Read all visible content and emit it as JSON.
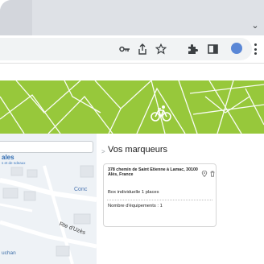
{
  "browser": {
    "icons": [
      {
        "name": "key-icon",
        "glyph": "⊶"
      },
      {
        "name": "share-icon",
        "glyph": ""
      },
      {
        "name": "star-icon",
        "glyph": "☆"
      },
      {
        "name": "extensions-icon",
        "glyph": ""
      },
      {
        "name": "side-panel-icon",
        "glyph": ""
      }
    ],
    "tab_dropdown_glyph": "⌄",
    "profile_color": "#5a87d6"
  },
  "banner": {
    "color": "#97c83b",
    "line_color": "#ffffff",
    "icon": "bicycle-icon"
  },
  "map": {
    "label_main": "ales",
    "label_sub": "s et de ndeaux",
    "label_conc": "Conc",
    "label_road": "Rte d'Uzès",
    "label_bottom": "uchan"
  },
  "panel": {
    "caret": ">",
    "title": "Vos marqueurs",
    "card": {
      "address": "378 chemin de Saint Etienne à Lamac, 30100 Alès, France",
      "type": "Box individuelle 1 places",
      "count": "Nombre d'équipements : 1"
    }
  }
}
